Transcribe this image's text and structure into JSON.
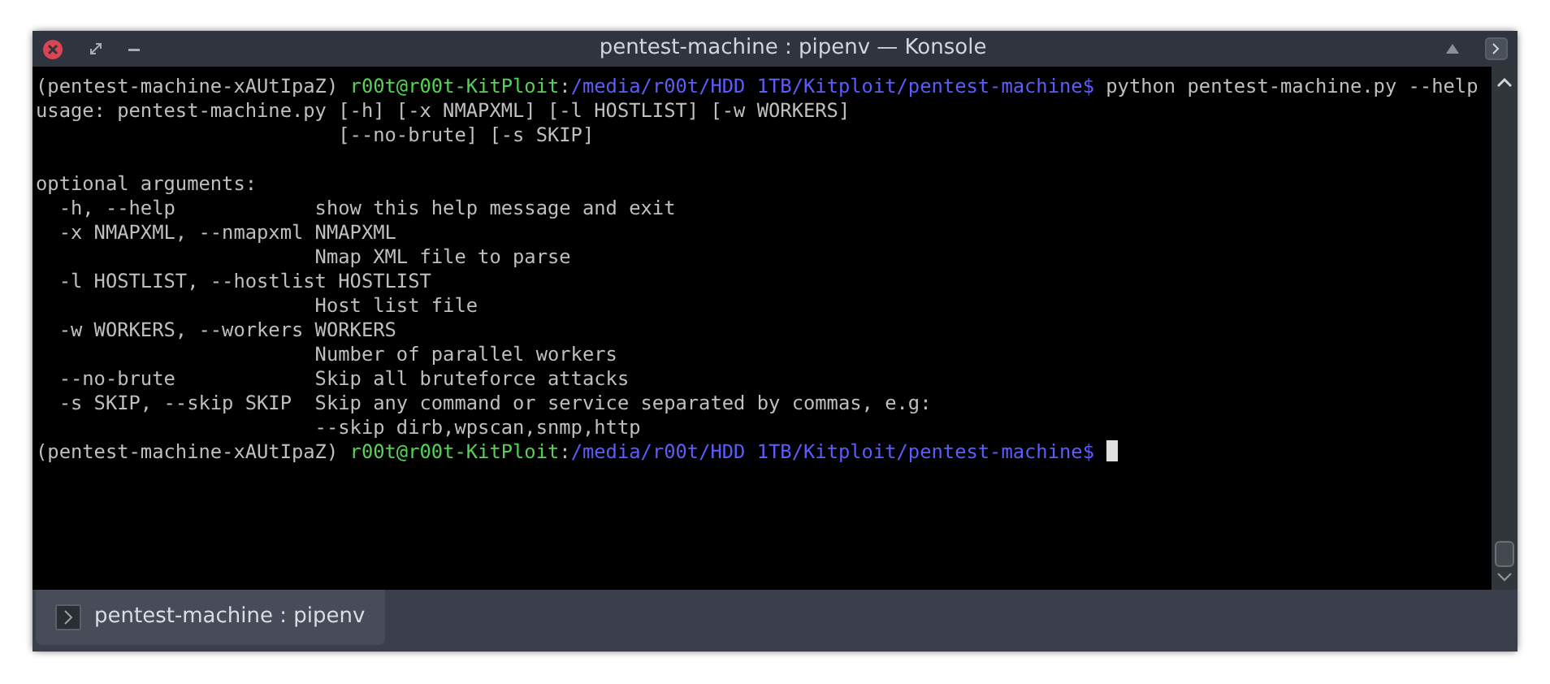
{
  "window": {
    "title": "pentest-machine : pipenv — Konsole"
  },
  "terminal": {
    "lines": [
      {
        "kind": "prompt",
        "env": "(pentest-machine-xAUtIpaZ) ",
        "user": "r00t@r00t-KitPloit",
        "sep": ":",
        "path": "/media/r00t/HDD 1TB/Kitploit/pentest-machine",
        "symbol": "$",
        "command": " python pentest-machine.py --help",
        "cursor": false
      },
      {
        "kind": "text",
        "text": "usage: pentest-machine.py [-h] [-x NMAPXML] [-l HOSTLIST] [-w WORKERS]"
      },
      {
        "kind": "text",
        "text": "                          [--no-brute] [-s SKIP]"
      },
      {
        "kind": "blank"
      },
      {
        "kind": "text",
        "text": "optional arguments:"
      },
      {
        "kind": "text",
        "text": "  -h, --help            show this help message and exit"
      },
      {
        "kind": "text",
        "text": "  -x NMAPXML, --nmapxml NMAPXML"
      },
      {
        "kind": "text",
        "text": "                        Nmap XML file to parse"
      },
      {
        "kind": "text",
        "text": "  -l HOSTLIST, --hostlist HOSTLIST"
      },
      {
        "kind": "text",
        "text": "                        Host list file"
      },
      {
        "kind": "text",
        "text": "  -w WORKERS, --workers WORKERS"
      },
      {
        "kind": "text",
        "text": "                        Number of parallel workers"
      },
      {
        "kind": "text",
        "text": "  --no-brute            Skip all bruteforce attacks"
      },
      {
        "kind": "text",
        "text": "  -s SKIP, --skip SKIP  Skip any command or service separated by commas, e.g:"
      },
      {
        "kind": "text",
        "text": "                        --skip dirb,wpscan,snmp,http"
      },
      {
        "kind": "prompt",
        "env": "(pentest-machine-xAUtIpaZ) ",
        "user": "r00t@r00t-KitPloit",
        "sep": ":",
        "path": "/media/r00t/HDD 1TB/Kitploit/pentest-machine",
        "symbol": "$",
        "cursor": true
      }
    ]
  },
  "tabs": [
    {
      "label": "pentest-machine : pipenv",
      "selected": true
    }
  ]
}
